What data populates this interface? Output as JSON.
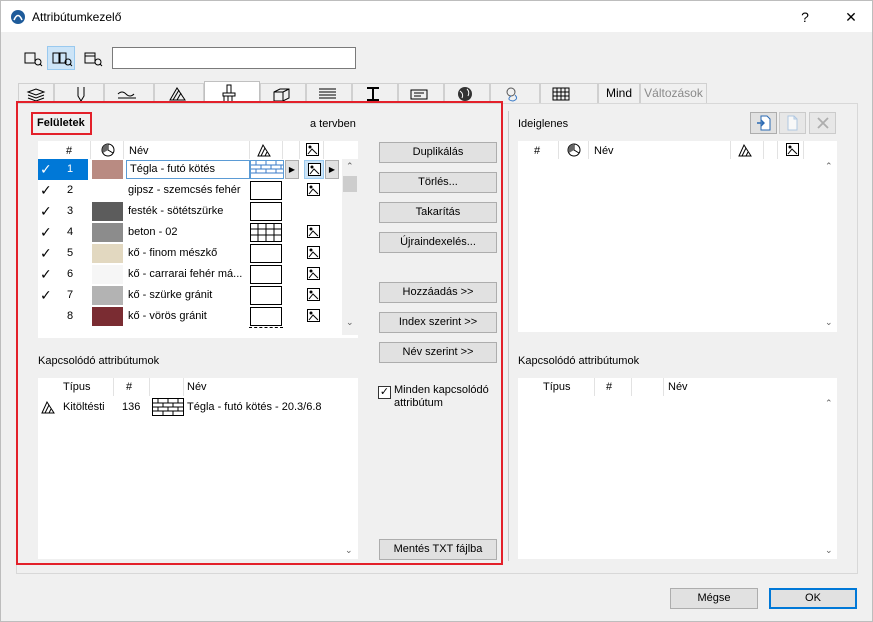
{
  "window": {
    "title": "Attribútumkezelő",
    "help_label": "?",
    "close_label": "✕"
  },
  "search": {
    "value": "",
    "placeholder": ""
  },
  "tabs": [
    {
      "label": "",
      "icon": "layers-icon"
    },
    {
      "label": "",
      "icon": "pen-icon"
    },
    {
      "label": "",
      "icon": "line-types-icon"
    },
    {
      "label": "",
      "icon": "fill-hatch-icon"
    },
    {
      "label": "",
      "icon": "paint-brush-surfaces-icon",
      "active": true
    },
    {
      "label": "",
      "icon": "building-material-icon"
    },
    {
      "label": "",
      "icon": "composite-icon"
    },
    {
      "label": "",
      "icon": "profile-icon"
    },
    {
      "label": "",
      "icon": "globe-icon"
    },
    {
      "label": "",
      "icon": "mep-icon"
    },
    {
      "label": "",
      "icon": "zone-grid-icon"
    },
    {
      "label": "Mind"
    },
    {
      "label": "Változások",
      "disabled": true
    }
  ],
  "left": {
    "section_title": "Felületek",
    "scope_label": "a tervben",
    "columns": {
      "num": "#",
      "name": "Név"
    },
    "rows": [
      {
        "check": "✓",
        "num": "1",
        "color": "#b98b82",
        "name": "Tégla - futó kötés",
        "fill": "brick",
        "texture": true,
        "selected": true
      },
      {
        "check": "✓",
        "num": "2",
        "color": "#ffffff",
        "name": "gipsz - szemcsés fehér",
        "fill": "empty",
        "texture": true
      },
      {
        "check": "✓",
        "num": "3",
        "color": "#5c5c5c",
        "name": "festék - sötétszürke",
        "fill": "empty",
        "texture": false
      },
      {
        "check": "✓",
        "num": "4",
        "color": "#8c8c8c",
        "name": "beton - 02",
        "fill": "grid",
        "texture": true
      },
      {
        "check": "✓",
        "num": "5",
        "color": "#e2d8c0",
        "name": "kő - finom mészkő",
        "fill": "empty",
        "texture": true
      },
      {
        "check": "✓",
        "num": "6",
        "color": "#f6f6f6",
        "name": "kő - carrarai fehér má...",
        "fill": "empty",
        "texture": true
      },
      {
        "check": "✓",
        "num": "7",
        "color": "#b3b3b3",
        "name": "kő - szürke gránit",
        "fill": "empty",
        "texture": true
      },
      {
        "check": "",
        "num": "8",
        "color": "#7a2c32",
        "name": "kő - vörös gránit",
        "fill": "empty",
        "texture": true
      }
    ],
    "related_title": "Kapcsolódó attribútumok",
    "related_columns": {
      "type": "Típus",
      "num": "#",
      "name": "Név"
    },
    "related_rows": [
      {
        "type": "Kitöltésti",
        "num": "136",
        "name": "Tégla - futó kötés - 20.3/6.8"
      }
    ]
  },
  "buttons": {
    "duplicate": "Duplikálás",
    "delete": "Törlés...",
    "purge": "Takarítás",
    "reindex": "Újraindexelés...",
    "add": "Hozzáadás >>",
    "by_index": "Index szerint >>",
    "by_name": "Név szerint >>",
    "all_related_checkbox": "Minden kapcsolódó attribútum",
    "save_txt": "Mentés TXT fájlba",
    "cancel": "Mégse",
    "ok": "OK"
  },
  "right": {
    "title": "Ideiglenes",
    "columns": {
      "num": "#",
      "name": "Név"
    },
    "related_title": "Kapcsolódó attribútumok",
    "related_columns": {
      "type": "Típus",
      "num": "#",
      "name": "Név"
    }
  },
  "colors": {
    "highlight_red": "#e3202a",
    "selection_blue": "#0078d7",
    "active_tab_bg": "#ffffff"
  }
}
